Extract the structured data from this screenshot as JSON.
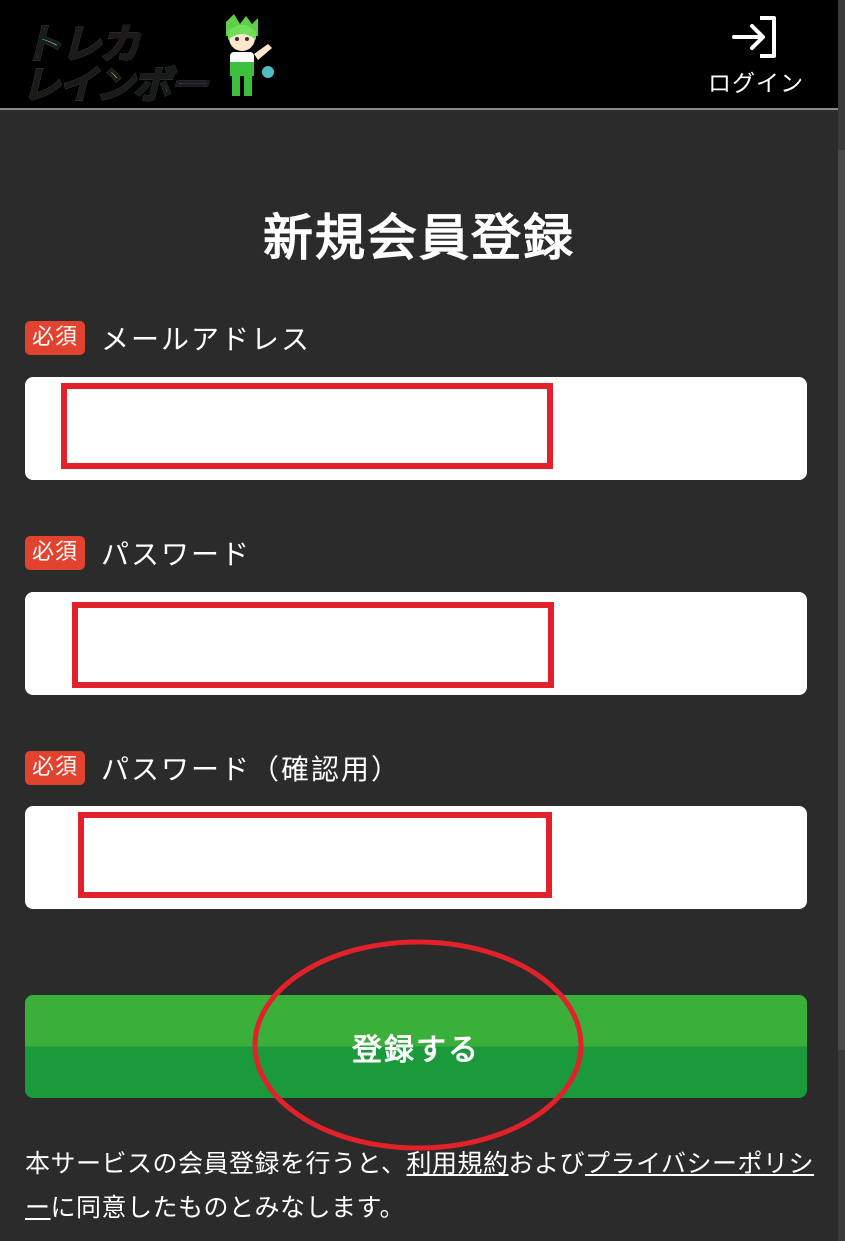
{
  "header": {
    "logo": {
      "line1": "トレカ",
      "line2": "レインボー"
    },
    "login_label": "ログイン"
  },
  "page": {
    "title": "新規会員登録"
  },
  "form": {
    "fields": [
      {
        "badge": "必須",
        "label": "メールアドレス",
        "value": ""
      },
      {
        "badge": "必須",
        "label": "パスワード",
        "value": ""
      },
      {
        "badge": "必須",
        "label": "パスワード（確認用）",
        "value": ""
      }
    ],
    "submit_label": "登録する"
  },
  "notice": {
    "prefix": "本サービスの会員登録を行うと、",
    "terms_link": "利用規約",
    "middle": "および",
    "privacy_link": "プライバシーポリシー",
    "suffix": "に同意したものとみなします。"
  },
  "colors": {
    "background": "#2b2b2b",
    "header": "#000000",
    "badge": "#e2432e",
    "button_top": "#3aaf3a",
    "button_bottom": "#1a9a3a",
    "annotation": "#e3212b"
  }
}
